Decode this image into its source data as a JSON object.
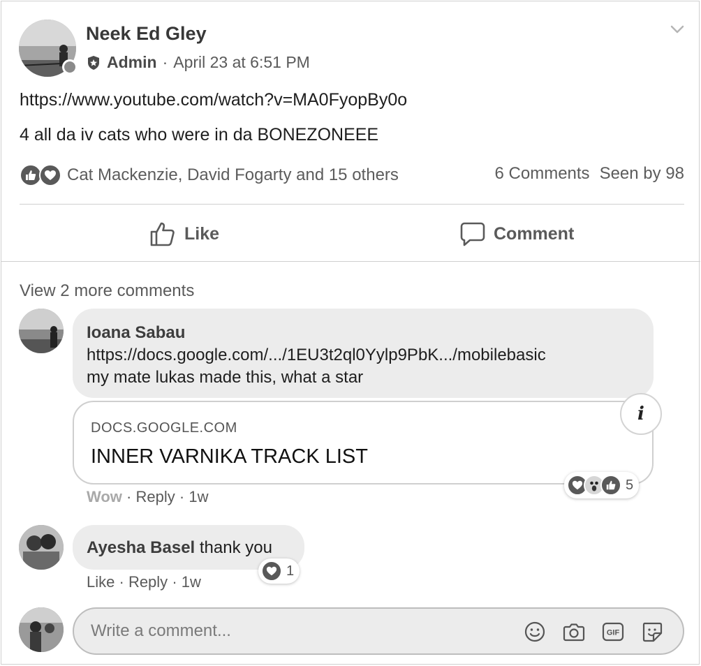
{
  "post": {
    "author": "Neek Ed Gley",
    "role": "Admin",
    "separator": "·",
    "timestamp": "April 23 at 6:51 PM",
    "link": "https://www.youtube.com/watch?v=MA0FyopBy0o",
    "text": "4 all da iv cats who were in da BONEZONEEE",
    "reaction_names": "Cat Mackenzie, David Fogarty and 15 others",
    "comments_count": "6 Comments",
    "seen_by": "Seen by 98",
    "reaction_icons": [
      "like-icon",
      "love-icon"
    ]
  },
  "actions": {
    "like": "Like",
    "comment": "Comment"
  },
  "view_more": "View 2 more comments",
  "comments": [
    {
      "name": "Ioana Sabau",
      "link": "https://docs.google.com/.../1EU3t2ql0Yylp9PbK.../mobilebasic",
      "text": "my mate lukas made this, what a star",
      "preview_domain": "DOCS.GOOGLE.COM",
      "preview_title": "INNER VARNIKA TRACK LIST",
      "action_reaction": "Wow",
      "reply": "Reply",
      "time": "1w",
      "reaction_count": "5",
      "reaction_icons": [
        "love-icon",
        "wow-icon",
        "like-icon"
      ]
    },
    {
      "name": "Ayesha Basel",
      "text": "thank you",
      "like": "Like",
      "reply": "Reply",
      "time": "1w",
      "reaction_count": "1",
      "reaction_icons": [
        "love-icon"
      ]
    }
  ],
  "composer": {
    "placeholder": "Write a comment...",
    "icons": [
      "emoji-icon",
      "camera-icon",
      "gif-icon",
      "sticker-icon"
    ]
  },
  "dot": "·"
}
